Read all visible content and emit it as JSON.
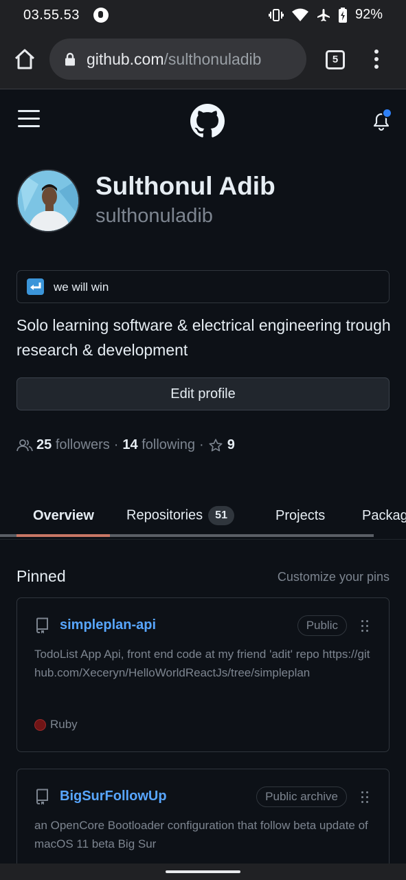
{
  "status_bar": {
    "time": "03.55.53",
    "battery": "92%",
    "icons": [
      "vibrate-icon",
      "wifi-icon",
      "airplane-icon",
      "battery-charging-icon"
    ]
  },
  "browser": {
    "url_host": "github.com",
    "url_path": "/sulthonuladib",
    "tab_count": "5"
  },
  "profile": {
    "display_name": "Sulthonul Adib",
    "username": "sulthonuladib",
    "status": "we will win",
    "bio": "Solo learning software & electrical engineering trough research & development",
    "edit_label": "Edit profile",
    "followers_count": "25",
    "followers_label": "followers",
    "following_count": "14",
    "following_label": "following",
    "stars_count": "9"
  },
  "tabs": [
    {
      "label": "Overview",
      "active": true
    },
    {
      "label": "Repositories",
      "count": "51"
    },
    {
      "label": "Projects"
    },
    {
      "label": "Packages"
    }
  ],
  "pinned": {
    "title": "Pinned",
    "customize_label": "Customize your pins",
    "repos": [
      {
        "name": "simpleplan-api",
        "visibility": "Public",
        "description": "TodoList App Api, front end code at my friend 'adit' repo https://github.com/Xeceryn/HelloWorldReactJs/tree/simpleplan",
        "language": "Ruby",
        "language_color": "#701516"
      },
      {
        "name": "BigSurFollowUp",
        "visibility": "Public archive",
        "description": "an OpenCore Bootloader configuration that follow beta update of macOS 11 beta Big Sur"
      }
    ]
  },
  "colors": {
    "background": "#0d1117",
    "link": "#58a6ff",
    "accent_underline": "#f78166",
    "notification_dot": "#2f81f7"
  }
}
